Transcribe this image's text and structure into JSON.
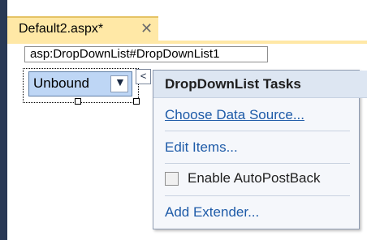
{
  "document_tab": {
    "title": "Default2.aspx*",
    "close_glyph": "✕"
  },
  "design_surface": {
    "control_tag": "asp:DropDownList#DropDownList1",
    "dropdown": {
      "value": "Unbound",
      "arrow": "▼"
    },
    "smart_tag_glyph": "<"
  },
  "tasks_panel": {
    "title": "DropDownList Tasks",
    "choose_data_source": "Choose Data Source...",
    "edit_items": "Edit Items...",
    "enable_autopostback": {
      "label": "Enable AutoPostBack",
      "checked": false
    },
    "add_extender": "Add Extender..."
  }
}
